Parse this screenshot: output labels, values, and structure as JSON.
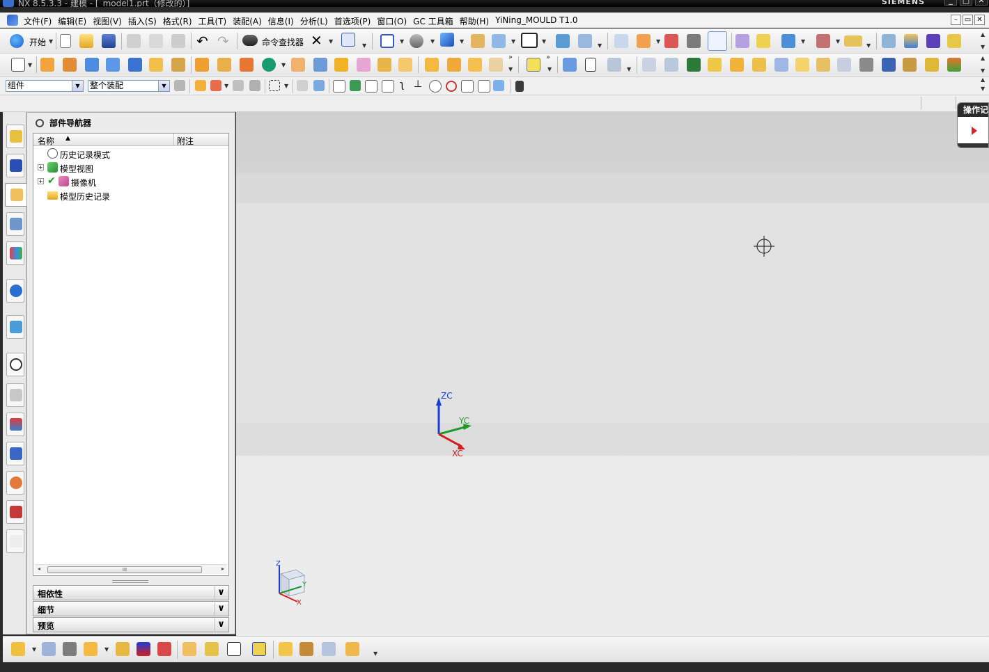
{
  "window": {
    "title": "NX 8.5.3.3 - 建模 - [_model1.prt（修改的）]",
    "brand": "SIEMENS",
    "min_label": "_",
    "max_label": "□",
    "close_label": "✕"
  },
  "menu": {
    "items": [
      "文件(F)",
      "编辑(E)",
      "视图(V)",
      "插入(S)",
      "格式(R)",
      "工具(T)",
      "装配(A)",
      "信息(I)",
      "分析(L)",
      "首选项(P)",
      "窗口(O)",
      "GC 工具箱",
      "帮助(H)",
      "YiNing_MOULD T1.0"
    ],
    "restore_label": "▭",
    "close_label": "✕"
  },
  "toolbar": {
    "start_label": "开始",
    "command_finder_label": "命令查找器"
  },
  "filters": {
    "type_filter": "组件",
    "scope_filter": "整个装配"
  },
  "navigator": {
    "title": "部件导航器",
    "col_name": "名称",
    "col_note": "附注",
    "rows": [
      {
        "label": "历史记录模式"
      },
      {
        "label": "模型视图"
      },
      {
        "label": "摄像机"
      },
      {
        "label": "模型历史记录"
      }
    ],
    "panels": [
      "相依性",
      "细节",
      "预览"
    ],
    "scroll_grip": "III"
  },
  "graphics": {
    "wcs_z": "ZC",
    "wcs_y": "YC",
    "wcs_x": "XC",
    "triad_z": "Z",
    "triad_y": "Y",
    "triad_x": "X",
    "ops_panel_title": "操作记"
  },
  "colors": {
    "axis_z": "#1a3fd8",
    "axis_y": "#1e9a2a",
    "axis_x": "#d21e1e"
  }
}
